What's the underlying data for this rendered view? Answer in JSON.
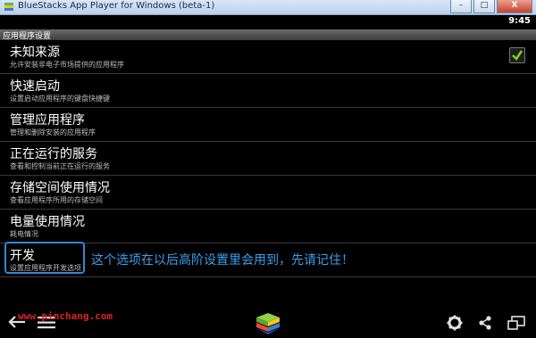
{
  "window": {
    "title": "BlueStacks App Player for Windows (beta-1)",
    "buttons": {
      "minimize": "–",
      "maximize": "□",
      "close": "X"
    }
  },
  "status_bar": {
    "time": "9:45"
  },
  "screen": {
    "header": "应用程序设置",
    "items": [
      {
        "title": "未知来源",
        "summary": "允许安装非电子市场提供的应用程序",
        "checked": true
      },
      {
        "title": "快速启动",
        "summary": "设置启动应用程序的键盘快捷键"
      },
      {
        "title": "管理应用程序",
        "summary": "管理和删除安装的应用程序"
      },
      {
        "title": "正在运行的服务",
        "summary": "查看和控制当前正在运行的服务"
      },
      {
        "title": "存储空间使用情况",
        "summary": "查看应用程序所用的存储空间"
      },
      {
        "title": "电量使用情况",
        "summary": "耗电情况"
      },
      {
        "title": "开发",
        "summary": "设置应用程序开发选项"
      }
    ],
    "annotation": "这个选项在以后高阶设置里会用到，先请记住！"
  },
  "watermark": "www.pinchang.com",
  "icons": {
    "back": "back-arrow-icon",
    "menu": "menu-icon",
    "home": "bluestacks-logo-icon",
    "settings": "gear-icon",
    "share": "share-icon",
    "window": "fullscreen-toggle-icon",
    "check": "checkmark-icon"
  },
  "colors": {
    "accent": "#2f8bd6",
    "annotation": "#3aa0ef",
    "watermark": "#e02020",
    "checkmark": "#7ed321"
  }
}
